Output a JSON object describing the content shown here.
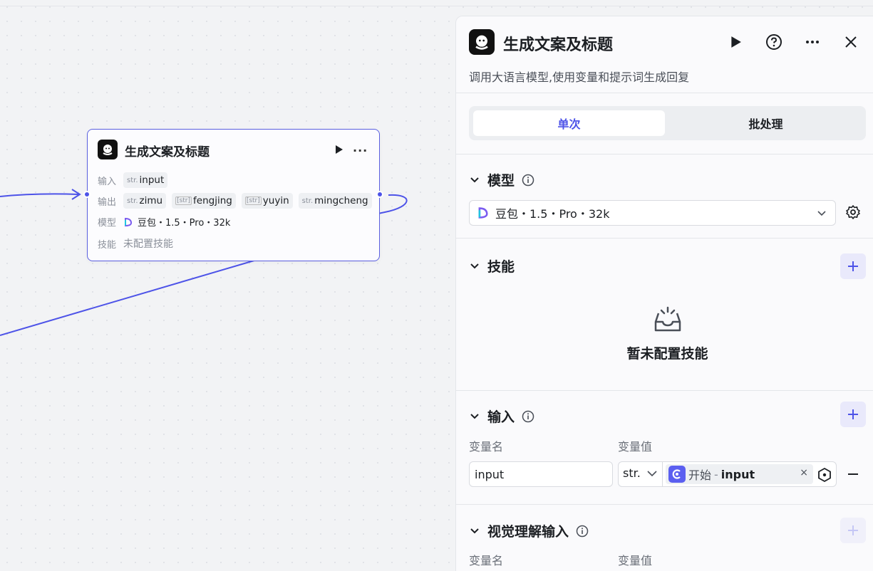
{
  "node": {
    "title": "生成文案及标题",
    "input_label": "输入",
    "output_label": "输出",
    "model_label": "模型",
    "skill_label": "技能",
    "inputs": [
      {
        "type": "str.",
        "name": "input"
      }
    ],
    "outputs": [
      {
        "type": "str.",
        "name": "zimu"
      },
      {
        "type": "[str]",
        "name": "fengjing"
      },
      {
        "type": "[str]",
        "name": "yuyin"
      },
      {
        "type": "str.",
        "name": "mingcheng"
      }
    ],
    "model_value": "豆包・1.5・Pro・32k",
    "skill_value": "未配置技能"
  },
  "panel": {
    "title": "生成文案及标题",
    "description": "调用大语言模型,使用变量和提示词生成回复",
    "tabs": [
      "单次",
      "批处理"
    ],
    "model_section": {
      "title": "模型",
      "selected": "豆包・1.5・Pro・32k"
    },
    "skill_section": {
      "title": "技能",
      "empty_text": "暂未配置技能"
    },
    "input_section": {
      "title": "输入",
      "col_name": "变量名",
      "col_value": "变量值",
      "row": {
        "name": "input",
        "type": "str.",
        "ref_source": "开始",
        "ref_sep": "-",
        "ref_var": "input"
      }
    },
    "vision_section": {
      "title": "视觉理解输入",
      "col_name": "变量名",
      "col_value": "变量值"
    }
  },
  "colors": {
    "accent": "#4d53e8",
    "node_border": "#5a5fe0"
  }
}
